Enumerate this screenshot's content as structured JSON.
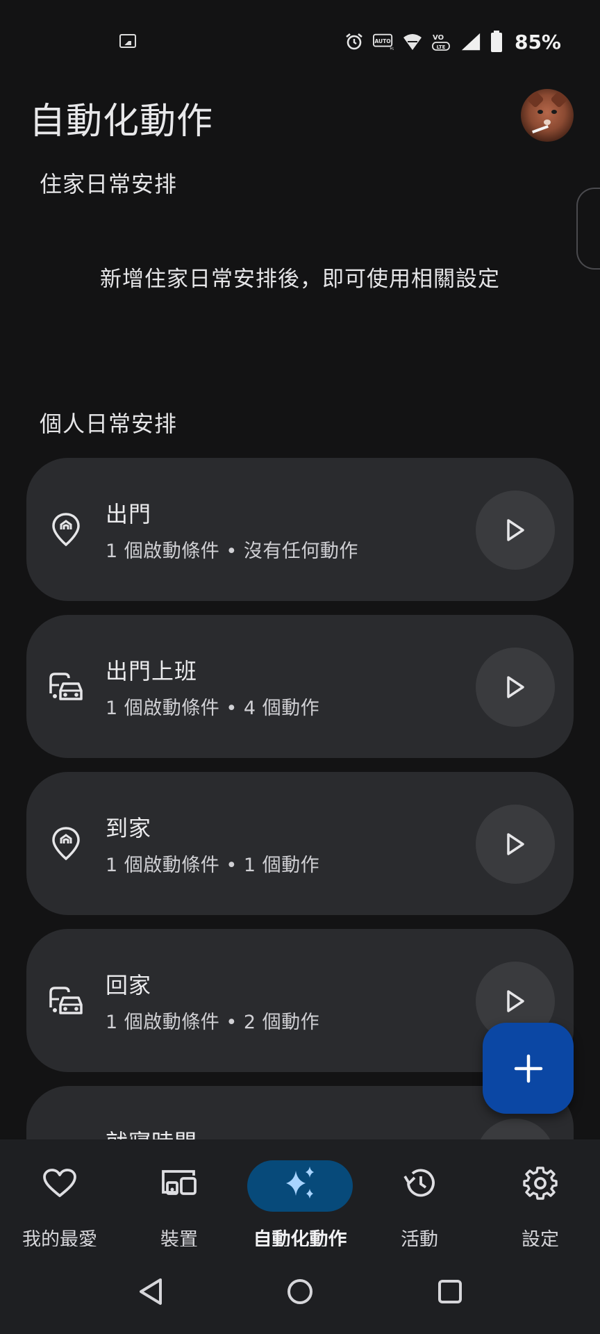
{
  "status_bar": {
    "battery_percent": "85%",
    "icons": [
      "image-icon",
      "alarm-icon",
      "auto-hz-icon",
      "wifi-icon",
      "volte-icon",
      "signal-icon",
      "battery-icon"
    ]
  },
  "header": {
    "title": "自動化動作"
  },
  "home_routines": {
    "title": "住家日常安排",
    "empty_message": "新增住家日常安排後，即可使用相關設定"
  },
  "personal_routines": {
    "title": "個人日常安排",
    "items": [
      {
        "name": "出門",
        "subtitle": "1 個啟動條件 • 沒有任何動作",
        "icon": "location-home-icon"
      },
      {
        "name": "出門上班",
        "subtitle": "1 個啟動條件 • 4 個動作",
        "icon": "commute-icon"
      },
      {
        "name": "到家",
        "subtitle": "1 個啟動條件 • 1 個動作",
        "icon": "location-home-icon"
      },
      {
        "name": "回家",
        "subtitle": "1 個啟動條件 • 2 個動作",
        "icon": "commute-icon"
      },
      {
        "name": "就寢時間",
        "subtitle": "",
        "icon": "bed-icon"
      }
    ]
  },
  "bottom_nav": {
    "items": [
      {
        "label": "我的最愛",
        "icon": "heart-icon"
      },
      {
        "label": "裝置",
        "icon": "devices-icon"
      },
      {
        "label": "自動化動作",
        "icon": "sparkle-icon",
        "active": true
      },
      {
        "label": "活動",
        "icon": "history-icon"
      },
      {
        "label": "設定",
        "icon": "gear-icon"
      }
    ]
  },
  "colors": {
    "background": "#131314",
    "card": "#2a2b2e",
    "fab": "#0b47a4",
    "active_pill": "#074a7a",
    "sparkle": "#a8d4ff"
  }
}
